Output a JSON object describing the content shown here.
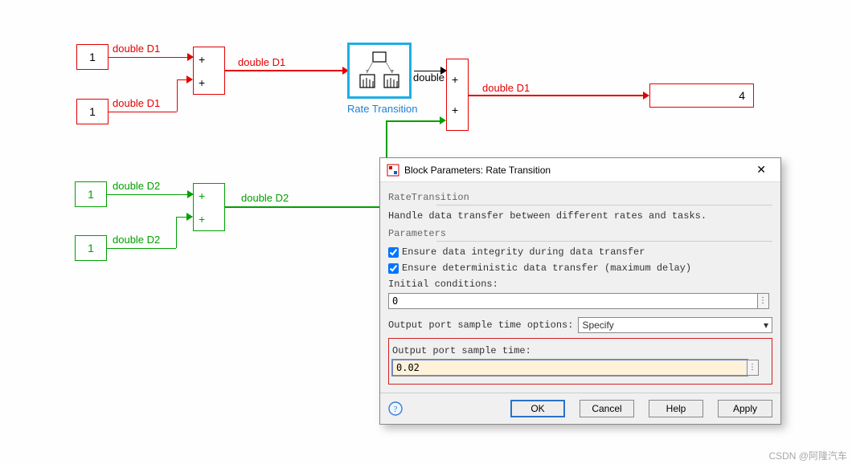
{
  "blocks": {
    "const1": "1",
    "const2": "1",
    "const3": "1",
    "const4": "1",
    "display": "4"
  },
  "labels": {
    "doubleD1_1": "double D1",
    "doubleD1_2": "double D1",
    "doubleD1_3": "double D1",
    "doubleD1_4": "double D1",
    "doubleD2_1": "double D2",
    "doubleD2_2": "double D2",
    "doubleD2_3": "double D2",
    "double": "double",
    "rate_trans": "Rate Transition"
  },
  "sum": {
    "plus": "+"
  },
  "dialog": {
    "title": "Block Parameters: Rate Transition",
    "section1": "RateTransition",
    "desc": "Handle data transfer between different rates and tasks.",
    "section2": "Parameters",
    "chk1": "Ensure data integrity during data transfer",
    "chk2": "Ensure deterministic data transfer (maximum delay)",
    "init_label": "Initial conditions:",
    "init_value": "0",
    "opts_label": "Output port sample time options:",
    "opts_value": "Specify",
    "st_label": "Output port sample time:",
    "st_value": "0.02",
    "ok": "OK",
    "cancel": "Cancel",
    "help": "Help",
    "apply": "Apply",
    "dots": "⋮"
  },
  "watermark": "CSDN @阿隆汽车"
}
